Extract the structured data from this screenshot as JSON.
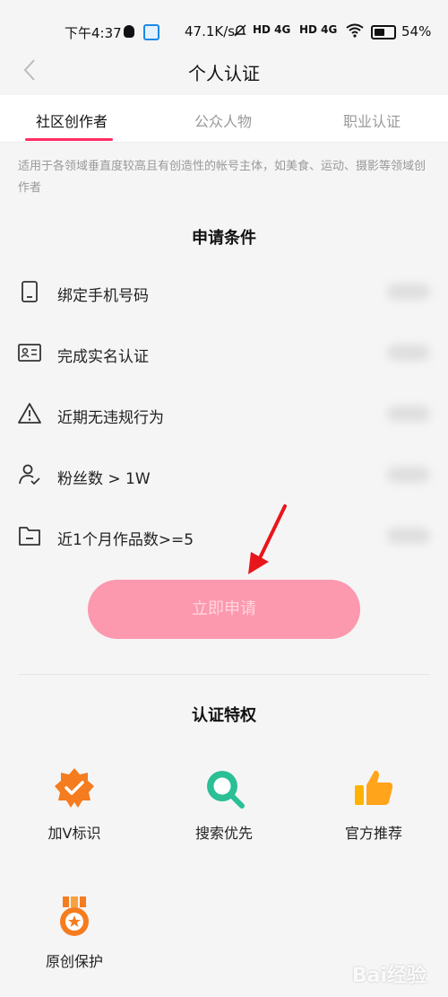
{
  "status_bar": {
    "time": "下午4:37",
    "network_speed": "47.1K/s",
    "sim1": "HD 4G",
    "sim2": "HD 4G",
    "battery": "54%"
  },
  "header": {
    "title": "个人认证"
  },
  "tabs": [
    {
      "label": "社区创作者",
      "active": true
    },
    {
      "label": "公众人物",
      "active": false
    },
    {
      "label": "职业认证",
      "active": false
    }
  ],
  "description": "适用于各领域垂直度较高且有创造性的帐号主体，如美食、运动、摄影等领域创作者",
  "conditions": {
    "title": "申请条件",
    "items": [
      {
        "label": "绑定手机号码",
        "icon": "phone-icon"
      },
      {
        "label": "完成实名认证",
        "icon": "id-card-icon"
      },
      {
        "label": "近期无违规行为",
        "icon": "warning-icon"
      },
      {
        "label": "粉丝数 > 1W",
        "icon": "user-check-icon"
      },
      {
        "label": "近1个月作品数>=5",
        "icon": "folder-icon"
      }
    ]
  },
  "apply_button": {
    "label": "立即申请"
  },
  "privileges": {
    "title": "认证特权",
    "items": [
      {
        "label": "加V标识",
        "icon": "verified-badge-icon"
      },
      {
        "label": "搜索优先",
        "icon": "search-icon"
      },
      {
        "label": "官方推荐",
        "icon": "thumbs-up-icon"
      },
      {
        "label": "原创保护",
        "icon": "medal-icon"
      }
    ]
  },
  "colors": {
    "accent": "#ff2e62",
    "button_bg": "#fc99ae",
    "icon_orange": "#f57c1f",
    "icon_green": "#2bbf96"
  },
  "watermark": "Bai经验"
}
